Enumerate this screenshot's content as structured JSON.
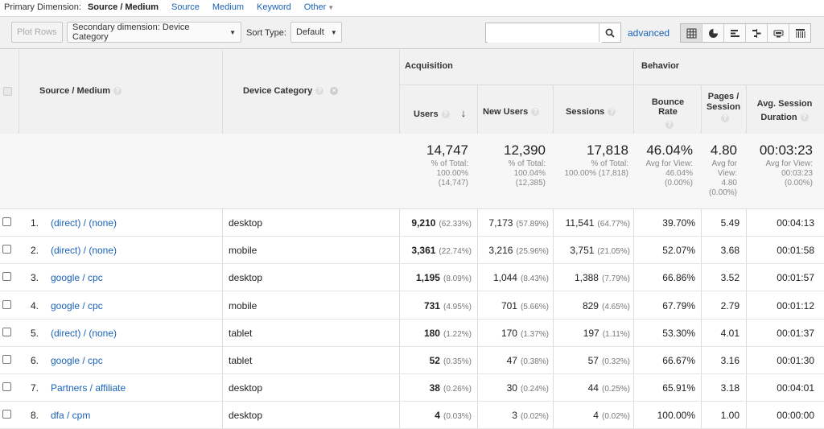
{
  "dimension_bar": {
    "label": "Primary Dimension:",
    "active": "Source / Medium",
    "options": [
      "Source",
      "Medium",
      "Keyword",
      "Other"
    ]
  },
  "toolbar": {
    "plot_rows": "Plot Rows",
    "secondary_dimension": "Secondary dimension: Device Category",
    "sort_type_label": "Sort Type:",
    "sort_type_value": "Default",
    "search_placeholder": "",
    "advanced": "advanced",
    "view_icons": [
      "table-view-icon",
      "pie-view-icon",
      "performance-view-icon",
      "comparison-view-icon",
      "term-cloud-icon",
      "pivot-view-icon"
    ]
  },
  "table": {
    "headers": {
      "source_medium": "Source / Medium",
      "device_category": "Device Category",
      "acquisition": "Acquisition",
      "behavior": "Behavior",
      "users": "Users",
      "new_users": "New Users",
      "sessions": "Sessions",
      "bounce_rate": "Bounce Rate",
      "pages_session_1": "Pages /",
      "pages_session_2": "Session",
      "avg_session_1": "Avg. Session",
      "avg_session_2": "Duration",
      "q": "?"
    },
    "totals": {
      "users": "14,747",
      "users_sub": [
        "% of Total:",
        "100.00%",
        "(14,747)"
      ],
      "new_users": "12,390",
      "new_users_sub": [
        "% of Total:",
        "100.04%",
        "(12,385)"
      ],
      "sessions": "17,818",
      "sessions_sub": [
        "% of Total:",
        "100.00% (17,818)"
      ],
      "bounce_rate": "46.04%",
      "bounce_rate_sub": [
        "Avg for View:",
        "46.04%",
        "(0.00%)"
      ],
      "pages": "4.80",
      "pages_sub": [
        "Avg for",
        "View:",
        "4.80",
        "(0.00%)"
      ],
      "duration": "00:03:23",
      "duration_sub": [
        "Avg for View:",
        "00:03:23",
        "(0.00%)"
      ]
    },
    "rows": [
      {
        "idx": "1.",
        "source": "(direct) / (none)",
        "device": "desktop",
        "users": "9,210",
        "users_pct": "(62.33%)",
        "new_users": "7,173",
        "new_users_pct": "(57.89%)",
        "sessions": "11,541",
        "sessions_pct": "(64.77%)",
        "bounce": "39.70%",
        "pages": "5.49",
        "duration": "00:04:13"
      },
      {
        "idx": "2.",
        "source": "(direct) / (none)",
        "device": "mobile",
        "users": "3,361",
        "users_pct": "(22.74%)",
        "new_users": "3,216",
        "new_users_pct": "(25.96%)",
        "sessions": "3,751",
        "sessions_pct": "(21.05%)",
        "bounce": "52.07%",
        "pages": "3.68",
        "duration": "00:01:58"
      },
      {
        "idx": "3.",
        "source": "google / cpc",
        "device": "desktop",
        "users": "1,195",
        "users_pct": "(8.09%)",
        "new_users": "1,044",
        "new_users_pct": "(8.43%)",
        "sessions": "1,388",
        "sessions_pct": "(7.79%)",
        "bounce": "66.86%",
        "pages": "3.52",
        "duration": "00:01:57"
      },
      {
        "idx": "4.",
        "source": "google / cpc",
        "device": "mobile",
        "users": "731",
        "users_pct": "(4.95%)",
        "new_users": "701",
        "new_users_pct": "(5.66%)",
        "sessions": "829",
        "sessions_pct": "(4.65%)",
        "bounce": "67.79%",
        "pages": "2.79",
        "duration": "00:01:12"
      },
      {
        "idx": "5.",
        "source": "(direct) / (none)",
        "device": "tablet",
        "users": "180",
        "users_pct": "(1.22%)",
        "new_users": "170",
        "new_users_pct": "(1.37%)",
        "sessions": "197",
        "sessions_pct": "(1.11%)",
        "bounce": "53.30%",
        "pages": "4.01",
        "duration": "00:01:37"
      },
      {
        "idx": "6.",
        "source": "google / cpc",
        "device": "tablet",
        "users": "52",
        "users_pct": "(0.35%)",
        "new_users": "47",
        "new_users_pct": "(0.38%)",
        "sessions": "57",
        "sessions_pct": "(0.32%)",
        "bounce": "66.67%",
        "pages": "3.16",
        "duration": "00:01:30"
      },
      {
        "idx": "7.",
        "source": "Partners / affiliate",
        "device": "desktop",
        "users": "38",
        "users_pct": "(0.26%)",
        "new_users": "30",
        "new_users_pct": "(0.24%)",
        "sessions": "44",
        "sessions_pct": "(0.25%)",
        "bounce": "65.91%",
        "pages": "3.18",
        "duration": "00:04:01"
      },
      {
        "idx": "8.",
        "source": "dfa / cpm",
        "device": "desktop",
        "users": "4",
        "users_pct": "(0.03%)",
        "new_users": "3",
        "new_users_pct": "(0.02%)",
        "sessions": "4",
        "sessions_pct": "(0.02%)",
        "bounce": "100.00%",
        "pages": "1.00",
        "duration": "00:00:00"
      }
    ]
  }
}
